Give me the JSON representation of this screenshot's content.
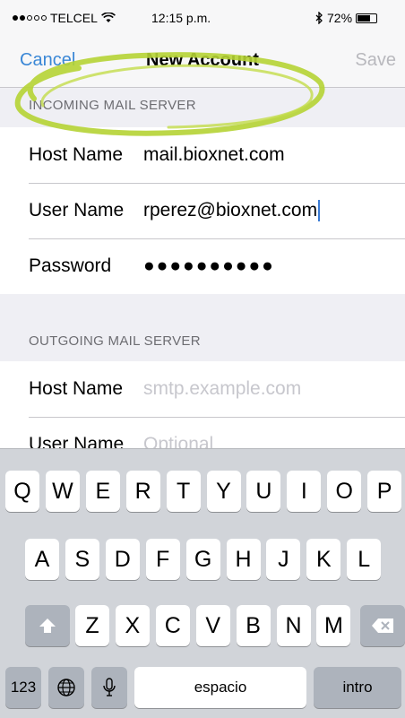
{
  "status_bar": {
    "carrier": "TELCEL",
    "time": "12:15 p.m.",
    "battery": "72%",
    "battery_level": 0.72,
    "icons": [
      "signal-dots-icon",
      "wifi-icon",
      "bluetooth-icon",
      "battery-icon"
    ]
  },
  "nav": {
    "cancel_label": "Cancel",
    "title": "New Account",
    "save_label": "Save"
  },
  "incoming": {
    "header": "INCOMING MAIL SERVER",
    "host_label": "Host Name",
    "host_value": "mail.bioxnet.com",
    "user_label": "User Name",
    "user_value": "rperez@bioxnet.com",
    "password_label": "Password",
    "password_value": "●●●●●●●●●●"
  },
  "outgoing": {
    "header": "OUTGOING MAIL SERVER",
    "host_label": "Host Name",
    "host_placeholder": "smtp.example.com",
    "user_label": "User Name",
    "user_placeholder": "Optional"
  },
  "keyboard": {
    "row1": [
      "Q",
      "W",
      "E",
      "R",
      "T",
      "Y",
      "U",
      "I",
      "O",
      "P"
    ],
    "row2": [
      "A",
      "S",
      "D",
      "F",
      "G",
      "H",
      "J",
      "K",
      "L"
    ],
    "row3": [
      "Z",
      "X",
      "C",
      "V",
      "B",
      "N",
      "M"
    ],
    "numbers_label": "123",
    "space_label": "espacio",
    "return_label": "intro"
  },
  "colors": {
    "accent": "#3a87d6",
    "annotation": "#b5d334",
    "background": "#efeff4"
  }
}
